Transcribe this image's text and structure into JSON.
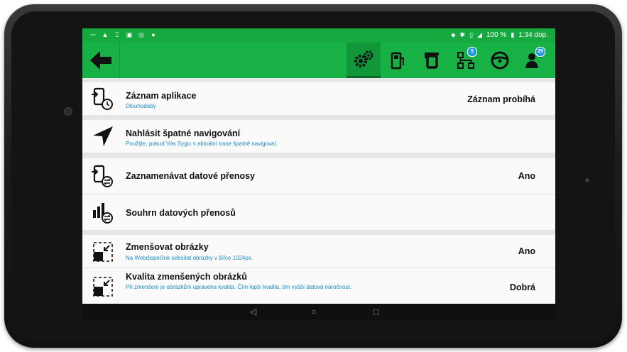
{
  "status_bar": {
    "left_icons": [
      "usb-icon",
      "warning-icon",
      "keyboard-icon",
      "image-icon",
      "eye-icon",
      "circle-icon"
    ],
    "right_icons": [
      "location-icon",
      "bluetooth-icon",
      "vibrate-icon",
      "signal-icon"
    ],
    "battery": "100 %",
    "time": "1:34 dop."
  },
  "toolbar": {
    "back_icon": "arrow-left-icon",
    "tabs": [
      {
        "icon": "gears-icon",
        "active": true
      },
      {
        "icon": "fuel-icon",
        "active": false
      },
      {
        "icon": "truck-icon",
        "active": false
      },
      {
        "icon": "route-icon",
        "badge": "5",
        "active": false
      },
      {
        "icon": "steering-wheel-icon",
        "active": false
      },
      {
        "icon": "driver-icon",
        "badge": "29",
        "active": false
      }
    ]
  },
  "settings": [
    {
      "icon": "phone-clock-icon",
      "title": "Záznam aplikace",
      "subtitle": "Dlouhodobý",
      "value": "Záznam probíhá"
    },
    {
      "icon": "navigation-arrow-icon",
      "title": "Nahlásit špatné navigování",
      "subtitle": "Použijte, pokud Vás Sygic v aktuální trase špatně navigoval.",
      "value": ""
    },
    {
      "icon": "phone-transfer-icon",
      "title": "Zaznamenávat datové přenosy",
      "subtitle": "",
      "value": "Ano"
    },
    {
      "icon": "chart-transfer-icon",
      "title": "Souhrn datových přenosů",
      "subtitle": "",
      "value": ""
    },
    {
      "icon": "image-resize-icon",
      "title": "Zmenšovat obrázky",
      "subtitle": "Na Webdispečink odesílat obrázky v šířce 1024px.",
      "value": "Ano"
    },
    {
      "icon": "image-quality-icon",
      "title": "Kvalita zmenšených obrázků",
      "subtitle": "Při zmenšení je obrázkům upravena kvalita. Čím lepší kvalita, tím vyšší datová náročnost.",
      "value": "Dobrá"
    }
  ],
  "nav_bar": {
    "back": "◁",
    "home": "○",
    "recents": "□"
  },
  "colors": {
    "accent": "#17b146",
    "status_bar": "#15a93f",
    "subtitle": "#1a8bc7",
    "badge": "#1e9be0"
  }
}
